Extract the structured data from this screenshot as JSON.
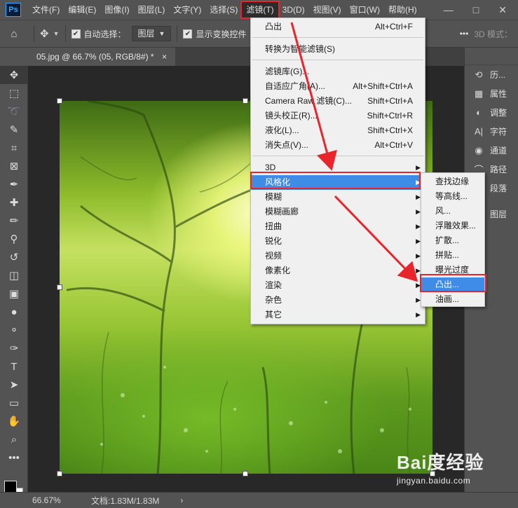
{
  "app": {
    "logo": "Ps"
  },
  "menubar": {
    "items": [
      "文件(F)",
      "编辑(E)",
      "图像(I)",
      "图层(L)",
      "文字(Y)",
      "选择(S)",
      "滤镜(T)",
      "3D(D)",
      "视图(V)",
      "窗口(W)",
      "帮助(H)"
    ],
    "active": "滤镜(T)",
    "window_controls": {
      "minimize": "—",
      "restore": "□",
      "close": "✕"
    }
  },
  "options": {
    "auto_select_label": "自动选择：",
    "auto_select_checked": true,
    "auto_select_target": "图层",
    "show_transform_label": "显示变换控件",
    "show_transform_checked": true,
    "more": "•••",
    "mode_3d": "3D 模式："
  },
  "document": {
    "tab_title": "05.jpg @ 66.7% (05, RGB/8#) *",
    "tab_close": "×"
  },
  "panels": [
    {
      "icon": "history-icon",
      "glyph": "⟲",
      "label": "历..."
    },
    {
      "icon": "properties-icon",
      "glyph": "▦",
      "label": "属性"
    },
    {
      "icon": "adjustments-icon",
      "glyph": "◐",
      "label": "调整"
    },
    {
      "icon": "character-icon",
      "glyph": "A|",
      "label": "字符"
    },
    {
      "icon": "channels-icon",
      "glyph": "◉",
      "label": "通道"
    },
    {
      "icon": "paths-icon",
      "glyph": "⌒",
      "label": "路径"
    },
    {
      "icon": "paragraph-icon",
      "glyph": "¶",
      "label": "段落"
    },
    {
      "icon": "layers-icon",
      "glyph": "◈",
      "label": "图层"
    }
  ],
  "status": {
    "zoom": "66.67%",
    "doc_size": "文档:1.83M/1.83M",
    "arrow": "›"
  },
  "filter_menu": {
    "items": [
      {
        "label": "凸出",
        "shortcut": "Alt+Ctrl+F"
      },
      {
        "label": "转换为智能滤镜(S)",
        "shortcut": ""
      },
      {
        "label": "滤镜库(G)...",
        "shortcut": ""
      },
      {
        "label": "自适应广角(A)...",
        "shortcut": "Alt+Shift+Ctrl+A"
      },
      {
        "label": "Camera Raw 滤镜(C)...",
        "shortcut": "Shift+Ctrl+A"
      },
      {
        "label": "镜头校正(R)...",
        "shortcut": "Shift+Ctrl+R"
      },
      {
        "label": "液化(L)...",
        "shortcut": "Shift+Ctrl+X"
      },
      {
        "label": "消失点(V)...",
        "shortcut": "Alt+Ctrl+V"
      },
      {
        "label": "3D",
        "shortcut": ""
      },
      {
        "label": "风格化",
        "shortcut": ""
      },
      {
        "label": "模糊",
        "shortcut": ""
      },
      {
        "label": "模糊画廊",
        "shortcut": ""
      },
      {
        "label": "扭曲",
        "shortcut": ""
      },
      {
        "label": "锐化",
        "shortcut": ""
      },
      {
        "label": "视频",
        "shortcut": ""
      },
      {
        "label": "像素化",
        "shortcut": ""
      },
      {
        "label": "渲染",
        "shortcut": ""
      },
      {
        "label": "杂色",
        "shortcut": ""
      },
      {
        "label": "其它",
        "shortcut": ""
      }
    ],
    "submenu_arrow": "▶"
  },
  "stylize_menu": {
    "items": [
      "查找边缘",
      "等高线...",
      "风...",
      "浮雕效果...",
      "扩散...",
      "拼贴...",
      "曝光过度",
      "凸出...",
      "油画..."
    ],
    "highlighted": "凸出..."
  },
  "watermark": {
    "brand": "Bai度经验",
    "url": "jingyan.baidu.com"
  },
  "colors": {
    "menu_highlight": "#3f8ce6",
    "annotation_red": "#e8252b",
    "ps_blue": "#31a8ff"
  }
}
